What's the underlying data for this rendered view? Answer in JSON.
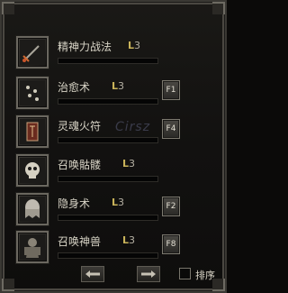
{
  "skills": [
    {
      "name": "精神力战法",
      "level_prefix": "L",
      "level": "3",
      "hotkey": "",
      "icon": "sword-icon"
    },
    {
      "name": "治愈术",
      "level_prefix": "L",
      "level": "3",
      "hotkey": "F1",
      "icon": "sparkle-icon"
    },
    {
      "name": "灵魂火符",
      "level_prefix": "L",
      "level": "3",
      "hotkey": "F4",
      "icon": "talisman-icon"
    },
    {
      "name": "召唤骷髅",
      "level_prefix": "L",
      "level": "3",
      "hotkey": "",
      "icon": "skull-icon"
    },
    {
      "name": "隐身术",
      "level_prefix": "L",
      "level": "3",
      "hotkey": "F2",
      "icon": "ghost-icon"
    },
    {
      "name": "召唤神兽",
      "level_prefix": "L",
      "level": "3",
      "hotkey": "F8",
      "icon": "beast-icon"
    }
  ],
  "footer": {
    "prev_icon": "arrow-left-icon",
    "next_icon": "arrow-right-icon",
    "sort_label": "排序",
    "sort_checked": false
  },
  "colors": {
    "text": "#d8d4c6",
    "level_letter": "#c9b35a",
    "frame": "#6a675f",
    "panel": "#121110"
  }
}
